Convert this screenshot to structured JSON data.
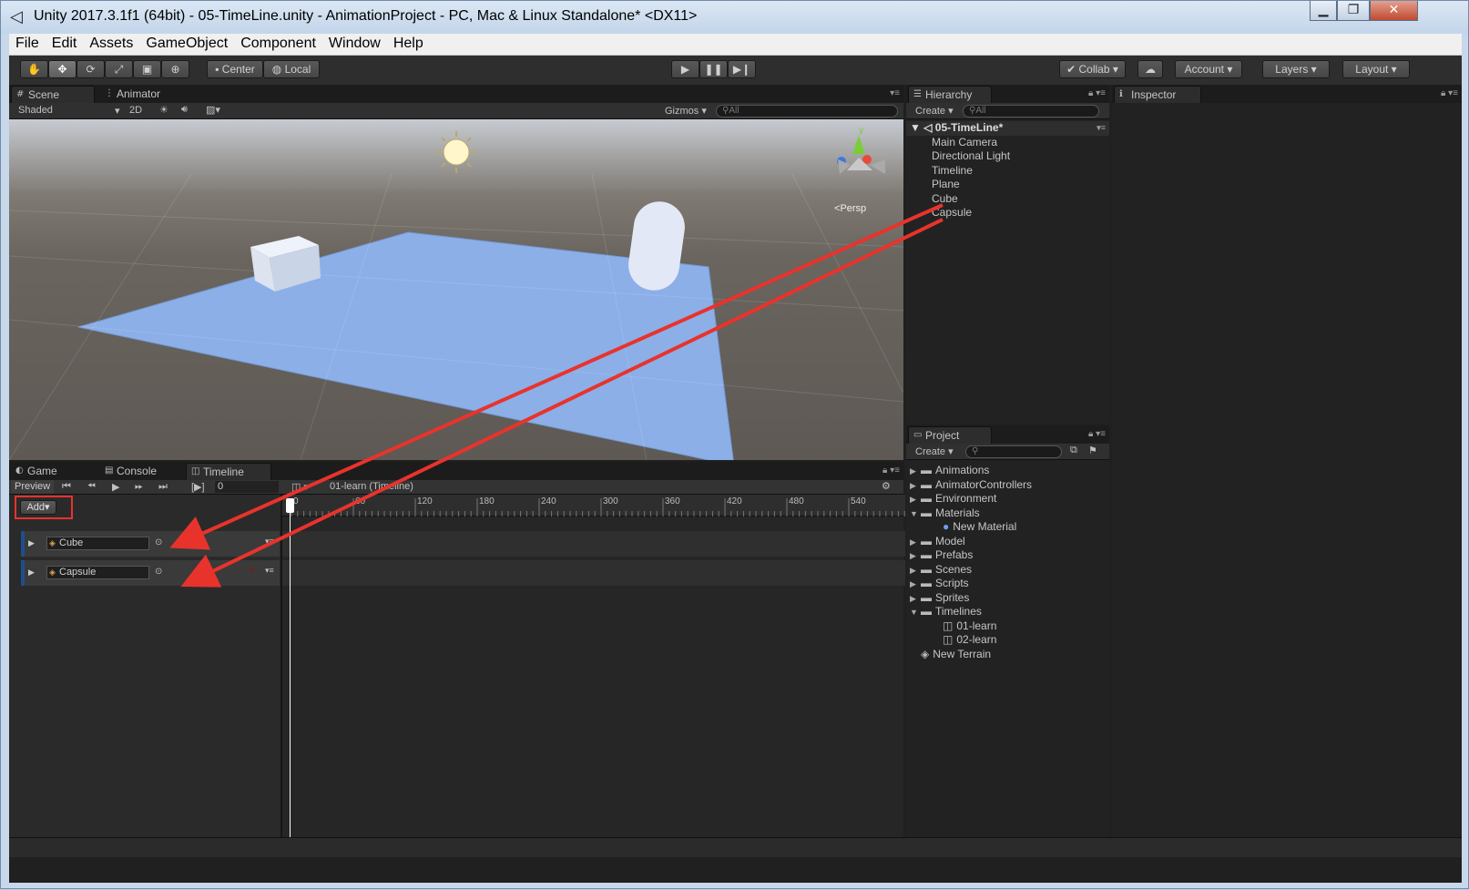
{
  "window": {
    "title": "Unity 2017.3.1f1 (64bit) - 05-TimeLine.unity - AnimationProject - PC, Mac & Linux Standalone* <DX11>",
    "minimize": "▁",
    "maximize": "❐",
    "close": "✕"
  },
  "menu": [
    "File",
    "Edit",
    "Assets",
    "GameObject",
    "Component",
    "Window",
    "Help"
  ],
  "toolbar": {
    "pivot": "Center",
    "space": "Local",
    "collab": "Collab",
    "account": "Account",
    "layers": "Layers",
    "layout": "Layout"
  },
  "scene": {
    "tabs": [
      "Scene",
      "Animator"
    ],
    "shading": "Shaded",
    "mode2d": "2D",
    "gizmos": "Gizmos",
    "search": "All",
    "persp": "Persp",
    "gizmo_y": "y"
  },
  "hierarchy": {
    "tab": "Hierarchy",
    "create": "Create",
    "search": "All",
    "scene_name": "05-TimeLine*",
    "items": [
      "Main Camera",
      "Directional Light",
      "Timeline",
      "Plane",
      "Cube",
      "Capsule"
    ]
  },
  "inspector": {
    "tab": "Inspector"
  },
  "project": {
    "tab": "Project",
    "create": "Create",
    "folders": [
      {
        "label": "Animations",
        "open": false,
        "depth": 0
      },
      {
        "label": "AnimatorControllers",
        "open": false,
        "depth": 0
      },
      {
        "label": "Environment",
        "open": false,
        "depth": 0
      },
      {
        "label": "Materials",
        "open": true,
        "depth": 0
      },
      {
        "label": "New Material",
        "depth": 1,
        "kind": "material"
      },
      {
        "label": "Model",
        "open": false,
        "depth": 0
      },
      {
        "label": "Prefabs",
        "open": false,
        "depth": 0
      },
      {
        "label": "Scenes",
        "open": false,
        "depth": 0
      },
      {
        "label": "Scripts",
        "open": false,
        "depth": 0
      },
      {
        "label": "Sprites",
        "open": false,
        "depth": 0
      },
      {
        "label": "Timelines",
        "open": true,
        "depth": 0
      },
      {
        "label": "01-learn",
        "depth": 1,
        "kind": "timeline"
      },
      {
        "label": "02-learn",
        "depth": 1,
        "kind": "timeline"
      },
      {
        "label": "New Terrain",
        "depth": 0,
        "kind": "terrain"
      }
    ]
  },
  "timeline": {
    "tabs": [
      "Game",
      "Console",
      "Timeline"
    ],
    "preview": "Preview",
    "frame": "0",
    "asset": "01-learn (Timeline)",
    "add": "Add",
    "ticks": [
      "0",
      "60",
      "120",
      "180",
      "240",
      "300",
      "360",
      "420",
      "480",
      "540"
    ],
    "tracks": [
      "Cube",
      "Capsule"
    ]
  },
  "colors": {
    "accent": "#1d4f8f",
    "annotation": "#e8332c",
    "plane": "#8fb0e6"
  }
}
